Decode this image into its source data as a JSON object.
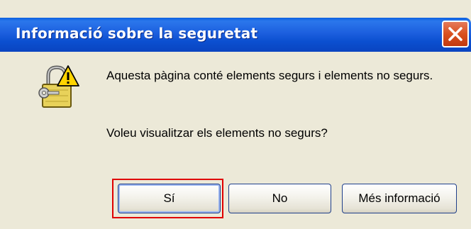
{
  "window": {
    "title": "Informació sobre la seguretat"
  },
  "icons": {
    "close": "close-icon",
    "main": "lock-warning-icon"
  },
  "message": {
    "line1": "Aquesta pàgina conté elements segurs i elements no segurs.",
    "line2": "Voleu visualitzar els elements no segurs?"
  },
  "buttons": {
    "yes": "Sí",
    "no": "No",
    "more_info": "Més informació"
  },
  "colors": {
    "titlebar": "#0b4fd0",
    "close_button": "#d9501f",
    "dialog_background": "#ece9d8",
    "focus_highlight": "#e00000"
  }
}
